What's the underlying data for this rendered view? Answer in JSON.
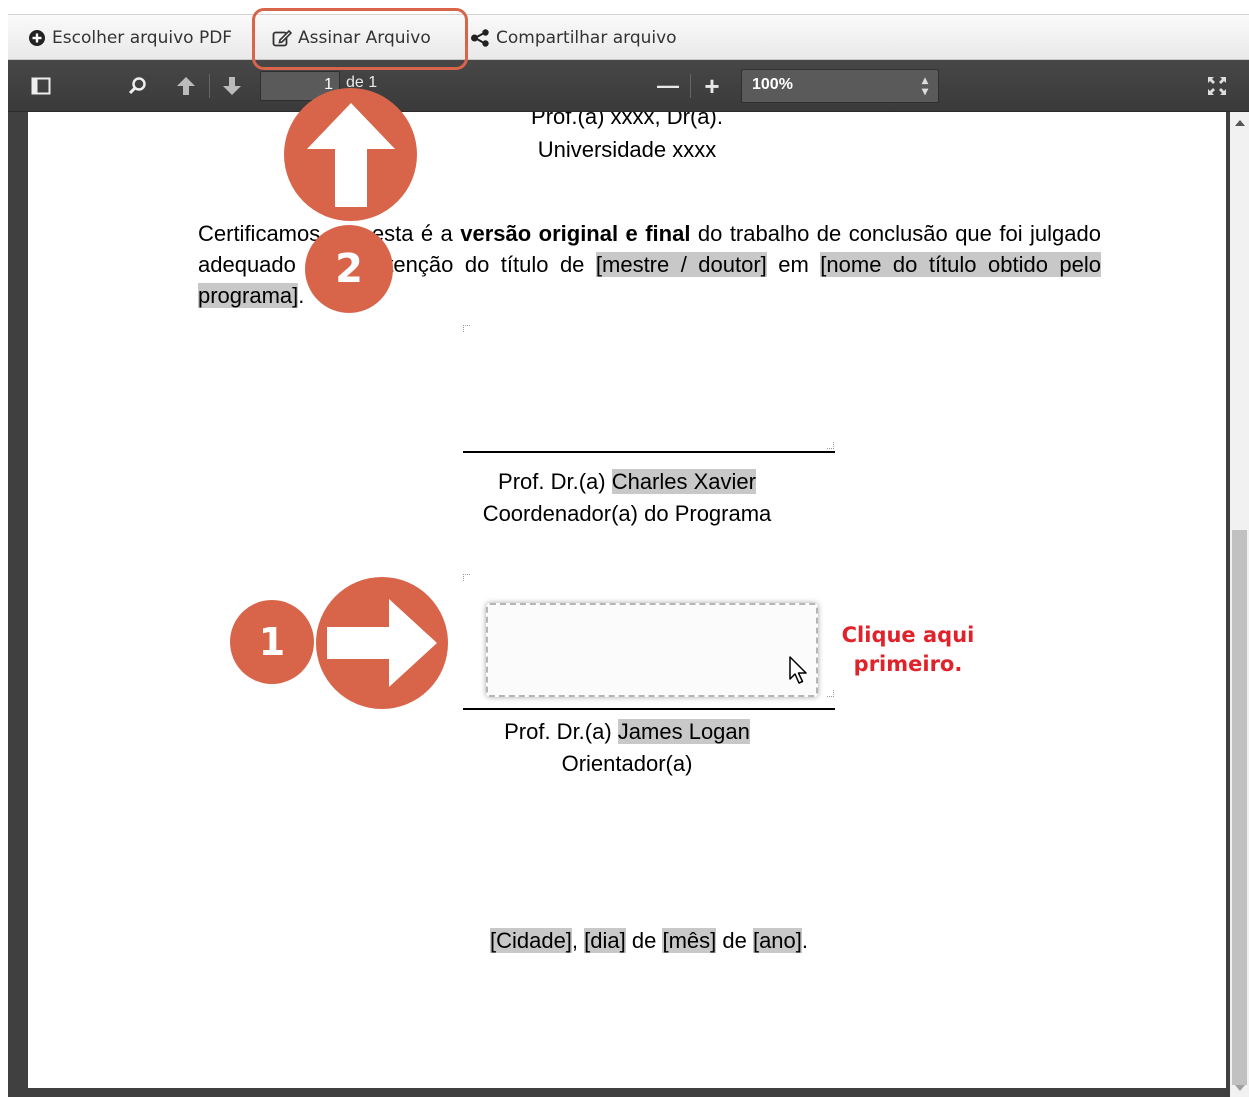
{
  "toolbar": {
    "choose_pdf_label": "Escolher arquivo PDF",
    "sign_label": "Assinar Arquivo",
    "share_label": "Compartilhar arquivo"
  },
  "viewer": {
    "page_current": "1",
    "page_of": "de 1",
    "zoom_value": "100%",
    "zoom_minus": "—",
    "zoom_plus": "+"
  },
  "document": {
    "examiner_name": "Prof.(a)  xxxx, Dr(a).",
    "examiner_university": "Universidade xxxx",
    "cert_prefix": "Certificamos que esta é a ",
    "cert_bold": "versão original e final",
    "cert_mid": " do trabalho de conclusão que foi julgado adequado para obtenção do título de ",
    "cert_degree": "[mestre / doutor]",
    "cert_em": " em ",
    "cert_title": "[nome do título obtido pelo programa]",
    "cert_end": ".",
    "coordinator_prefix": "Prof. Dr.(a) ",
    "coordinator_name": "Charles Xavier",
    "coordinator_role": "Coordenador(a) do Programa",
    "advisor_prefix": "Prof. Dr.(a) ",
    "advisor_name": "James Logan",
    "advisor_role": "Orientador(a)",
    "city": "[Cidade]",
    "comma": ", ",
    "day": "[dia]",
    "de1": " de ",
    "month": "[mês]",
    "de2": " de ",
    "year": "[ano]",
    "final_dot": "."
  },
  "annotations": {
    "hint_text": "Clique aqui primeiro.",
    "step1": "1",
    "step2": "2",
    "accent_color": "#d8654a",
    "hint_color": "#e0232b"
  }
}
